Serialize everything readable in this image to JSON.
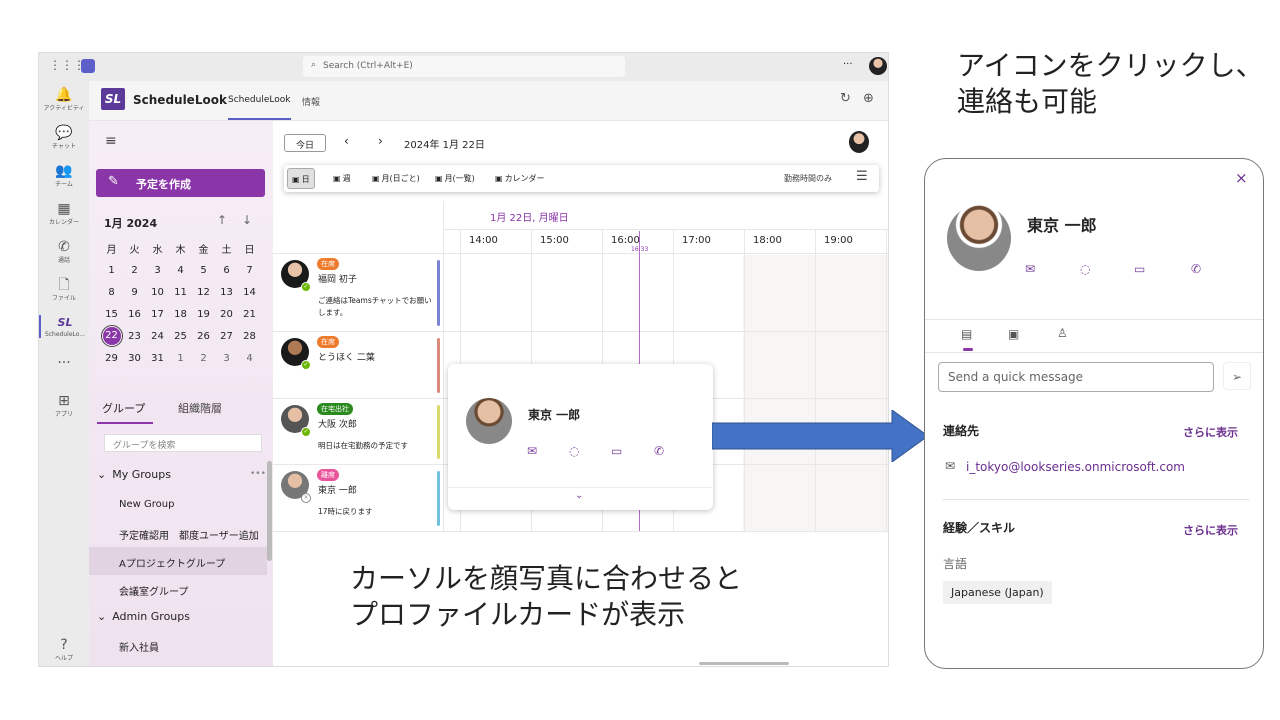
{
  "topbar": {
    "search_placeholder": "Search (Ctrl+Alt+E)",
    "more": "···"
  },
  "rail": [
    {
      "icon": "bell-icon",
      "glyph": "🔔",
      "label": "アクティビティ"
    },
    {
      "icon": "chat-icon",
      "glyph": "💬",
      "label": "チャット"
    },
    {
      "icon": "teams-icon",
      "glyph": "👥",
      "label": "チーム"
    },
    {
      "icon": "calendar-icon",
      "glyph": "▦",
      "label": "カレンダー"
    },
    {
      "icon": "phone-icon",
      "glyph": "✆",
      "label": "通話"
    },
    {
      "icon": "file-icon",
      "glyph": "🗋",
      "label": "ファイル"
    },
    {
      "icon": "schedulelook-icon",
      "glyph": "SL",
      "label": "ScheduleLo..."
    },
    {
      "icon": "more-icon",
      "glyph": "···",
      "label": ""
    },
    {
      "icon": "apps-icon",
      "glyph": "⊞",
      "label": "アプリ"
    }
  ],
  "rail_help": {
    "glyph": "?",
    "label": "ヘルプ"
  },
  "app": {
    "logo": "SL",
    "name": "ScheduleLook",
    "tabs": [
      "ScheduleLook",
      "情報"
    ],
    "active_tab": 0
  },
  "left": {
    "create_label": "予定を作成",
    "month_title": "1月 2024",
    "weekdays": [
      "月",
      "火",
      "水",
      "木",
      "金",
      "土",
      "日"
    ],
    "weeks": [
      [
        "1",
        "2",
        "3",
        "4",
        "5",
        "6",
        "7"
      ],
      [
        "8",
        "9",
        "10",
        "11",
        "12",
        "13",
        "14"
      ],
      [
        "15",
        "16",
        "17",
        "18",
        "19",
        "20",
        "21"
      ],
      [
        "22",
        "23",
        "24",
        "25",
        "26",
        "27",
        "28"
      ],
      [
        "29",
        "30",
        "31",
        "1",
        "2",
        "3",
        "4"
      ]
    ],
    "selected_day": "22",
    "tabs": [
      "グループ",
      "組織階層"
    ],
    "group_search_placeholder": "グループを検索",
    "groups": [
      {
        "label": "My Groups",
        "type": "header"
      },
      {
        "label": "New Group",
        "type": "item"
      },
      {
        "label": "予定確認用　都度ユーザー追加",
        "type": "item"
      },
      {
        "label": "Aプロジェクトグループ",
        "type": "item",
        "selected": true
      },
      {
        "label": "会議室グループ",
        "type": "item"
      },
      {
        "label": "Admin Groups",
        "type": "header"
      },
      {
        "label": "新入社員",
        "type": "item"
      }
    ]
  },
  "main": {
    "today_label": "今日",
    "date_label": "2024年 1月 22日",
    "views": [
      "日",
      "週",
      "月(日ごと)",
      "月(一覧)",
      "カレンダー"
    ],
    "active_view": 0,
    "work_hours_label": "勤務時間のみ",
    "day_header": "1月 22日, 月曜日",
    "hours": [
      "14:00",
      "15:00",
      "16:00",
      "17:00",
      "18:00",
      "19:00"
    ],
    "now_label": "16:33",
    "people": [
      {
        "status": "在席",
        "status_color": "#f07a2b",
        "name": "福岡 初子",
        "note": "ご連絡はTeamsチャットでお願いします。",
        "bar_color": "#7b83d4",
        "presence": "available"
      },
      {
        "status": "在席",
        "status_color": "#f07a2b",
        "name": "とうほく 二葉",
        "note": "",
        "bar_color": "#d98a7a",
        "presence": "available"
      },
      {
        "status": "在宅出社",
        "status_color": "#2a8a1e",
        "name": "大阪 次郎",
        "note": "明日は在宅勤務の予定です",
        "bar_color": "#d8dc6a",
        "presence": "available"
      },
      {
        "status": "離席",
        "status_color": "#e8559c",
        "name": "東京 一郎",
        "note": "17時に戻ります",
        "bar_color": "#72c2dd",
        "presence": "offline"
      }
    ]
  },
  "hover_card": {
    "name": "東京 一郎"
  },
  "profile_card": {
    "name": "東京 一郎",
    "message_placeholder": "Send a quick message",
    "contact": {
      "title": "連絡先",
      "more": "さらに表示",
      "email": "i_tokyo@lookseries.onmicrosoft.com"
    },
    "skills": {
      "title": "経験／スキル",
      "more": "さらに表示",
      "language_label": "言語",
      "language": "Japanese (Japan)"
    }
  },
  "annotations": {
    "top_right": [
      "アイコンをクリックし、",
      "連絡も可能"
    ],
    "bottom": [
      "カーソルを顔写真に合わせると",
      "プロファイルカードが表示"
    ]
  },
  "colors": {
    "accent": "#8a35a8",
    "arrow": "#4472c4"
  }
}
